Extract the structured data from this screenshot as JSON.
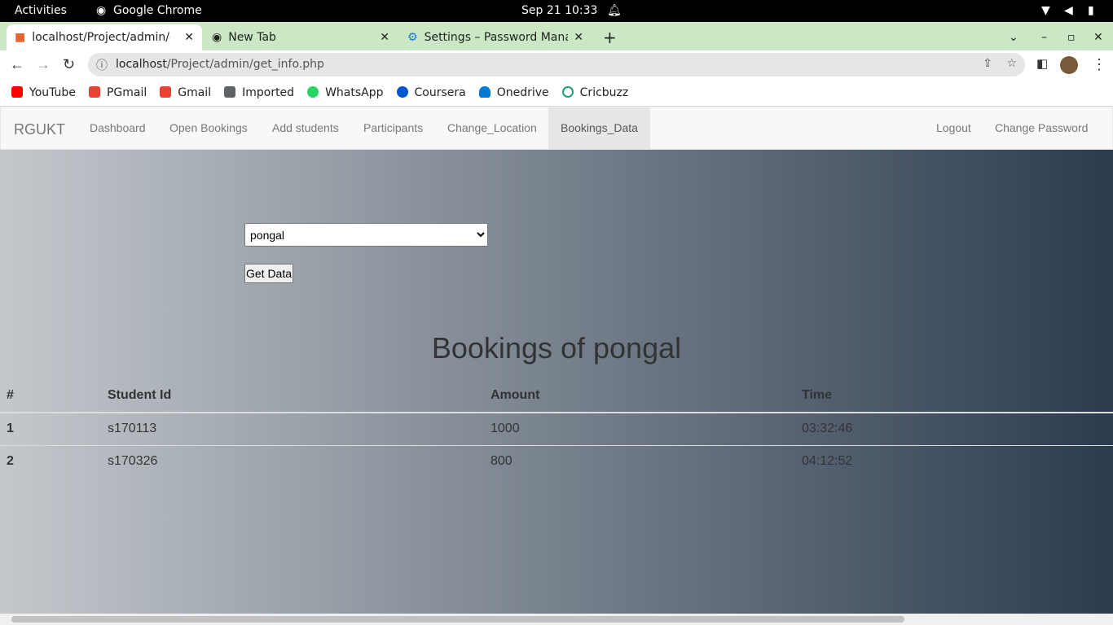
{
  "os": {
    "activities": "Activities",
    "app": "Google Chrome",
    "datetime": "Sep 21  10:33"
  },
  "tabs": [
    {
      "label": "localhost/Project/admin/get_info.php"
    },
    {
      "label": "New Tab"
    },
    {
      "label": "Settings – Password Manager"
    }
  ],
  "address": {
    "host": "localhost",
    "path": "/Project/admin/get_info.php"
  },
  "bookmarks": [
    {
      "label": "YouTube",
      "color": "#ff0000"
    },
    {
      "label": "PGmail",
      "color": "#ea4335"
    },
    {
      "label": "Gmail",
      "color": "#ea4335"
    },
    {
      "label": "Imported",
      "color": "#5f6368"
    },
    {
      "label": "WhatsApp",
      "color": "#25d366"
    },
    {
      "label": "Coursera",
      "color": "#0056d2"
    },
    {
      "label": "Onedrive",
      "color": "#0078d4"
    },
    {
      "label": "Cricbuzz",
      "color": "#1aa179"
    }
  ],
  "navbar": {
    "brand": "RGUKT",
    "items": [
      "Dashboard",
      "Open Bookings",
      "Add students",
      "Participants",
      "Change_Location",
      "Bookings_Data"
    ],
    "active": "Bookings_Data",
    "right": [
      "Logout",
      "Change Password"
    ]
  },
  "form": {
    "selected": "pongal",
    "button": "Get Data"
  },
  "heading": "Bookings of pongal",
  "table": {
    "headers": [
      "#",
      "Student Id",
      "Amount",
      "Time"
    ],
    "rows": [
      [
        "1",
        "s170113",
        "1000",
        "03:32:46"
      ],
      [
        "2",
        "s170326",
        "800",
        "04:12:52"
      ]
    ]
  }
}
